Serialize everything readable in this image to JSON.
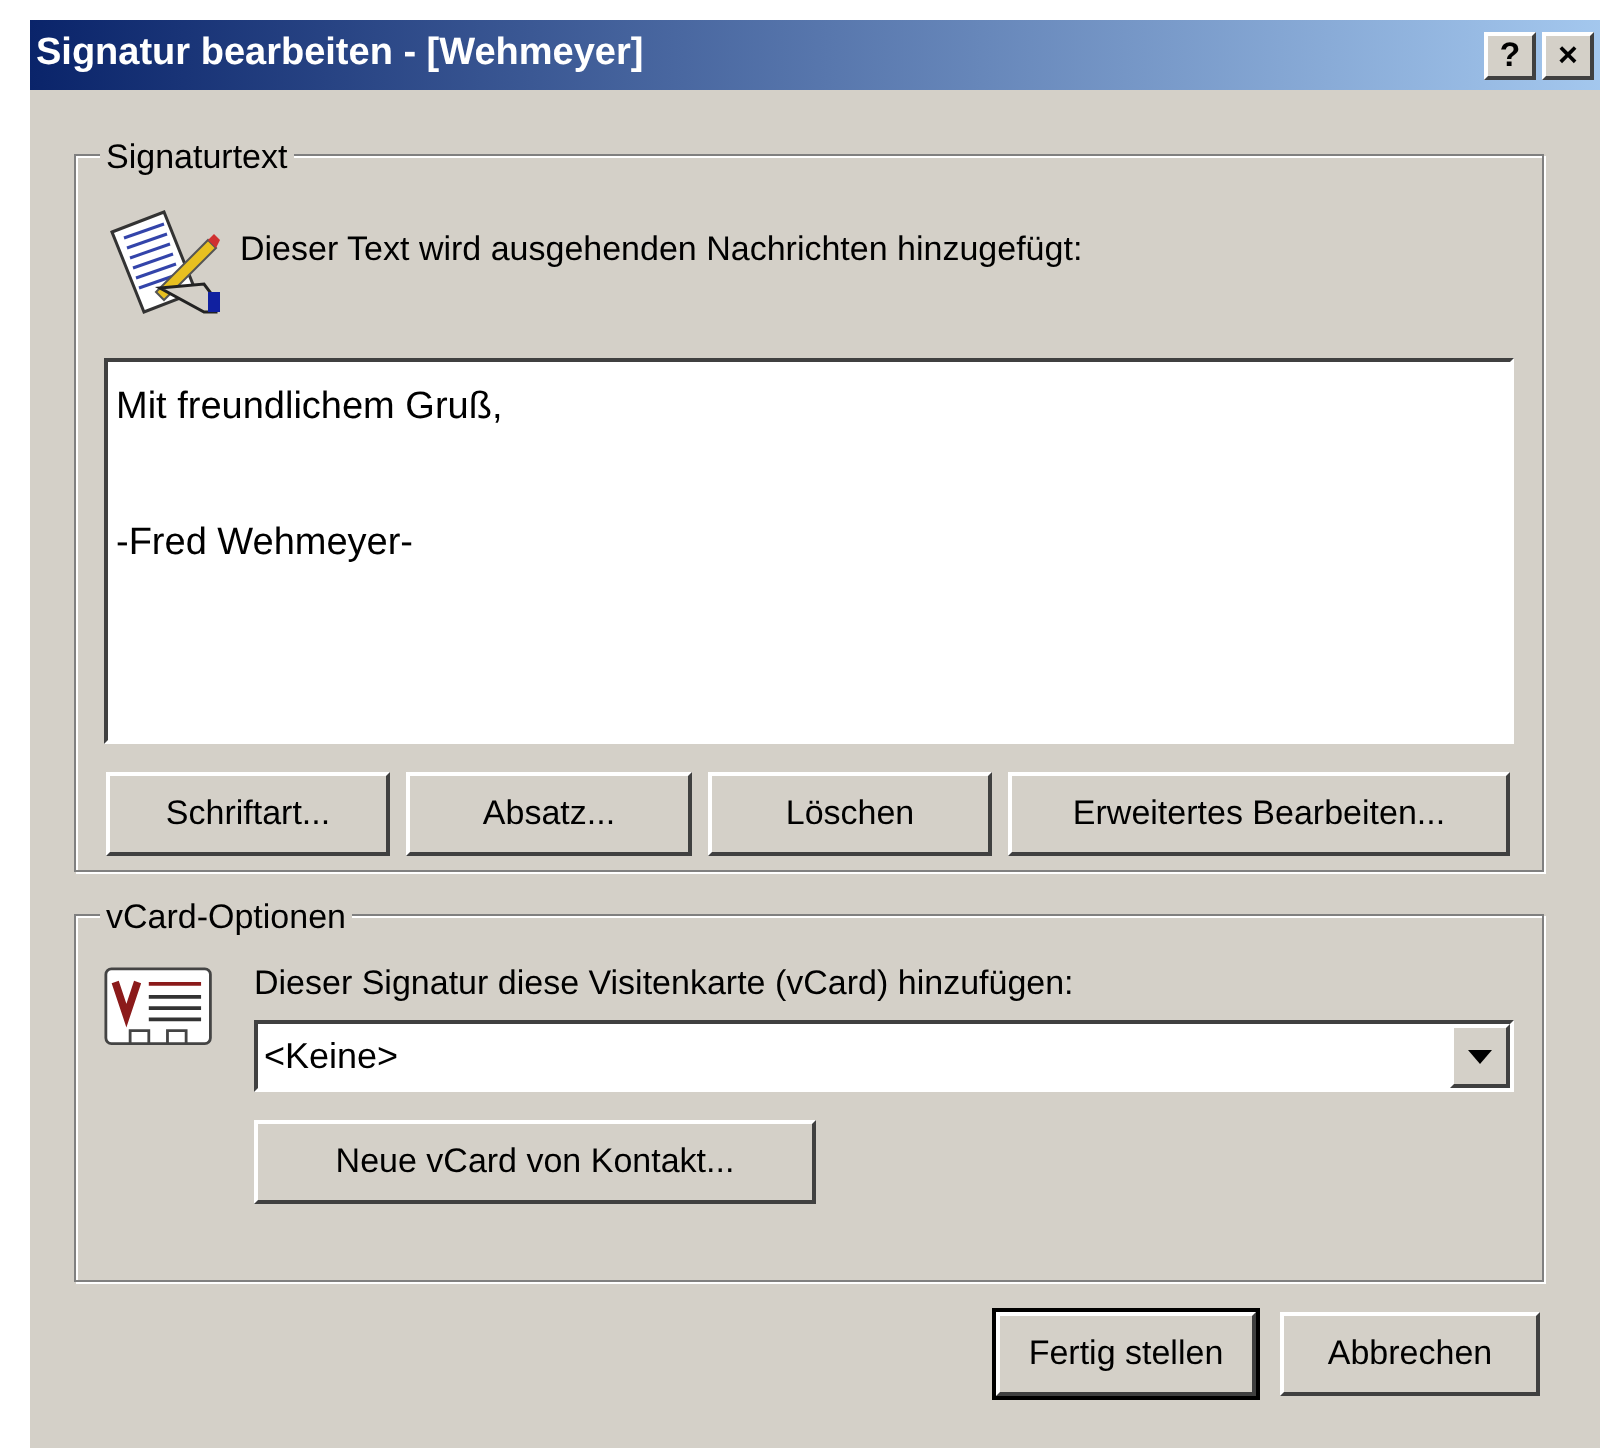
{
  "window": {
    "title": "Signatur bearbeiten - [Wehmeyer]",
    "title_buttons": [
      "?",
      "×"
    ]
  },
  "signature_group": {
    "legend": "Signaturtext",
    "prompt": "Dieser Text wird ausgehenden Nachrichten hinzugefügt:",
    "paragraphs": [
      "Mit freundlichem Gruß,",
      "-Fred Wehmeyer-"
    ],
    "buttons": [
      "Schriftart...",
      "Absatz...",
      "Löschen",
      "Erweitertes Bearbeiten..."
    ]
  },
  "vcard_group": {
    "legend": "vCard-Optionen",
    "prompt": "Dieser Signatur diese Visitenkarte (vCard) hinzufügen:",
    "dropdown": {
      "value": "<Keine>"
    },
    "button": "Neue vCard von Kontakt..."
  },
  "footer_buttons": [
    {
      "label": "Fertig stellen",
      "default": true
    },
    {
      "label": "Abbrechen",
      "default": false
    }
  ]
}
